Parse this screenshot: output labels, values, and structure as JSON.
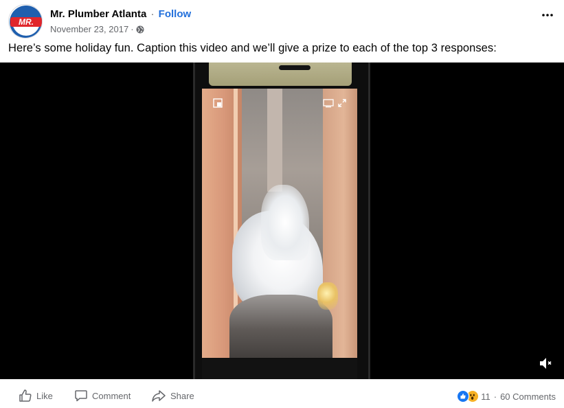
{
  "post": {
    "avatar_text": "MR.",
    "page_name": "Mr. Plumber Atlanta",
    "separator": "·",
    "follow_label": "Follow",
    "date": "November 23, 2017",
    "meta_dot": "·",
    "privacy_icon": "globe-icon",
    "more_icon": "more-options-icon",
    "caption": "Here’s some holiday fun. Caption this video and we’ll give a prize to each of the top 3 responses:"
  },
  "video": {
    "mute_icon": "volume-muted-icon"
  },
  "actions": {
    "like_label": "Like",
    "comment_label": "Comment",
    "share_label": "Share"
  },
  "stats": {
    "reaction_icons": [
      "like-reaction-icon",
      "wow-reaction-icon"
    ],
    "reaction_count": "11",
    "separator": "·",
    "comments_label": "60 Comments"
  },
  "colors": {
    "accent": "#216fdb",
    "text_secondary": "#65676b",
    "brand_red": "#e0262b",
    "brand_blue": "#1f5fae"
  }
}
